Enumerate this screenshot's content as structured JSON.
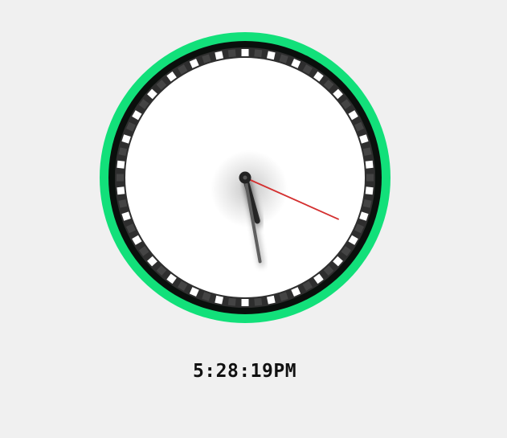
{
  "clock": {
    "hours": 5,
    "minutes": 28,
    "seconds": 19,
    "digital_display": "5:28:19PM",
    "colors": {
      "page_background": "#f0f0f0",
      "outer_ring": "#12e07a",
      "bezel": "#0a0f0c",
      "marker_track": "#2e2e2e",
      "marker": "#ffffff",
      "face": "#ffffff",
      "hour_hand": "#2a2a2a",
      "minute_hand": "#5f5f5f",
      "second_hand": "#d43030",
      "center_cap": "#222222"
    }
  }
}
